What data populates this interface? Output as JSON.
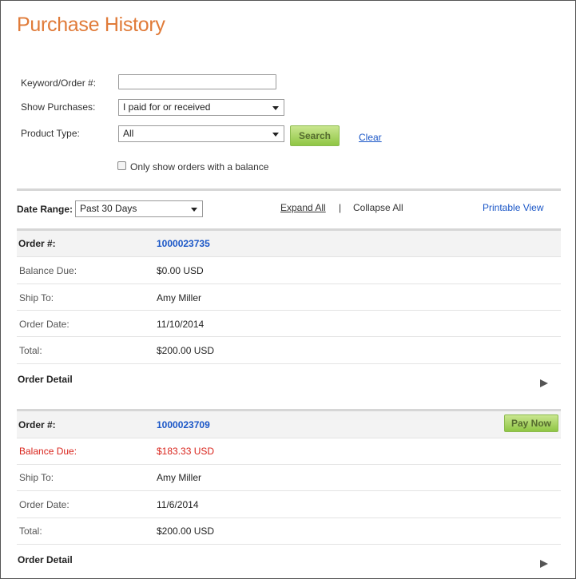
{
  "page": {
    "title": "Purchase History"
  },
  "filters": {
    "keyword_label": "Keyword/Order #:",
    "keyword_value": "",
    "show_purchases_label": "Show Purchases:",
    "show_purchases_value": "I paid for or received",
    "product_type_label": "Product Type:",
    "product_type_value": "All",
    "search_label": "Search",
    "clear_label": "Clear",
    "balance_checkbox_label": "Only show orders with a balance",
    "balance_checkbox_checked": false
  },
  "toolbar": {
    "date_range_label": "Date Range:",
    "date_range_value": "Past 30 Days",
    "expand_all": "Expand All",
    "separator": "|",
    "collapse_all": "Collapse All",
    "printable_view": "Printable View"
  },
  "orders": [
    {
      "order_label": "Order #:",
      "order_number": "1000023735",
      "balance_label": "Balance Due:",
      "balance": "$0.00 USD",
      "ship_to_label": "Ship To:",
      "ship_to": "Amy Miller",
      "order_date_label": "Order Date:",
      "order_date": "11/10/2014",
      "total_label": "Total:",
      "total": "$200.00 USD",
      "detail_label": "Order Detail"
    },
    {
      "order_label": "Order #:",
      "order_number": "1000023709",
      "pay_now": "Pay Now",
      "balance_label": "Balance Due:",
      "balance": "$183.33 USD",
      "ship_to_label": "Ship To:",
      "ship_to": "Amy Miller",
      "order_date_label": "Order Date:",
      "order_date": "11/6/2014",
      "total_label": "Total:",
      "total": "$200.00 USD",
      "detail_label": "Order Detail"
    }
  ],
  "colors": {
    "title": "#e07b39",
    "link": "#1a56c7",
    "balance_due_alert": "#d9241c",
    "button_green": "#8fc644"
  },
  "icons": {
    "expand_arrow": "triangle-right-icon",
    "dropdown": "chevron-down-icon"
  }
}
